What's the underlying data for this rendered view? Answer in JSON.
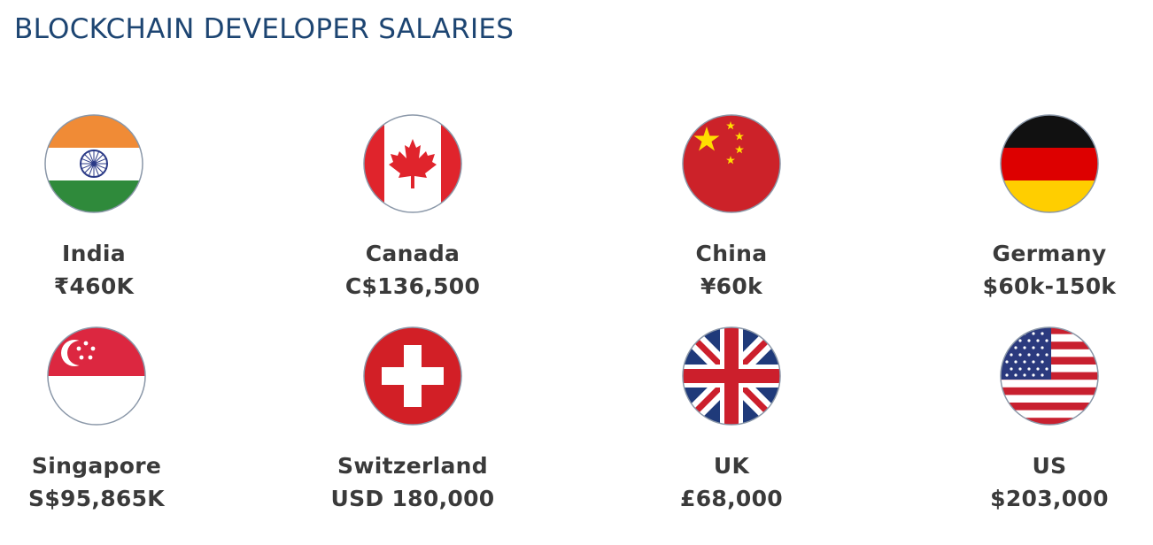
{
  "title": "BLOCKCHAIN DEVELOPER SALARIES",
  "colors": {
    "title": "#1d4572",
    "text": "#3a3a3a"
  },
  "countries": [
    {
      "name": "India",
      "salary": "₹460K",
      "flag_icon": "india-flag-icon"
    },
    {
      "name": "Canada",
      "salary": "C$136,500",
      "flag_icon": "canada-flag-icon"
    },
    {
      "name": "China",
      "salary": "¥60k",
      "flag_icon": "china-flag-icon"
    },
    {
      "name": "Germany",
      "salary": "$60k-150k",
      "flag_icon": "germany-flag-icon"
    },
    {
      "name": "Singapore",
      "salary": "S$95,865K",
      "flag_icon": "singapore-flag-icon"
    },
    {
      "name": "Switzerland",
      "salary": "USD 180,000",
      "flag_icon": "switzerland-flag-icon"
    },
    {
      "name": "UK",
      "salary": "£68,000",
      "flag_icon": "uk-flag-icon"
    },
    {
      "name": "US",
      "salary": "$203,000",
      "flag_icon": "us-flag-icon"
    }
  ]
}
